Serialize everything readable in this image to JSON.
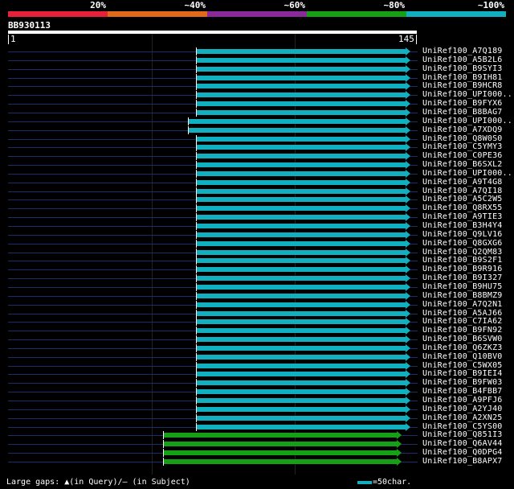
{
  "identity_legend": {
    "labels": [
      "20%",
      "~40%",
      "~60%",
      "~80%",
      "~100%"
    ],
    "colors": [
      "#e8203a",
      "#e06a18",
      "#8a2a9a",
      "#16a016",
      "#10b0c0"
    ]
  },
  "query": {
    "id": "BB930113",
    "start": "1",
    "end": "145",
    "length": 145
  },
  "hits": [
    {
      "label": "UniRef100_A7Q189",
      "q_start": 68,
      "q_end": 144,
      "color": "cyan"
    },
    {
      "label": "UniRef100_A5B2L6",
      "q_start": 68,
      "q_end": 144,
      "color": "cyan"
    },
    {
      "label": "UniRef100_B9SYI3",
      "q_start": 68,
      "q_end": 144,
      "color": "cyan"
    },
    {
      "label": "UniRef100_B9IH81",
      "q_start": 68,
      "q_end": 144,
      "color": "cyan"
    },
    {
      "label": "UniRef100_B9HCR8",
      "q_start": 68,
      "q_end": 144,
      "color": "cyan"
    },
    {
      "label": "UniRef100_UPI000..",
      "q_start": 68,
      "q_end": 144,
      "color": "cyan"
    },
    {
      "label": "UniRef100_B9FYX6",
      "q_start": 68,
      "q_end": 144,
      "color": "cyan"
    },
    {
      "label": "UniRef100_B8BAG7",
      "q_start": 68,
      "q_end": 144,
      "color": "cyan"
    },
    {
      "label": "UniRef100_UPI000..",
      "q_start": 65,
      "q_end": 144,
      "color": "cyan"
    },
    {
      "label": "UniRef100_A7XDQ9",
      "q_start": 65,
      "q_end": 144,
      "color": "cyan"
    },
    {
      "label": "UniRef100_Q8W0S0",
      "q_start": 68,
      "q_end": 144,
      "color": "cyan"
    },
    {
      "label": "UniRef100_C5YMY3",
      "q_start": 68,
      "q_end": 144,
      "color": "cyan"
    },
    {
      "label": "UniRef100_C0PE36",
      "q_start": 68,
      "q_end": 144,
      "color": "cyan"
    },
    {
      "label": "UniRef100_B6SXL2",
      "q_start": 68,
      "q_end": 144,
      "color": "cyan"
    },
    {
      "label": "UniRef100_UPI000..",
      "q_start": 68,
      "q_end": 144,
      "color": "cyan"
    },
    {
      "label": "UniRef100_A9T4G8",
      "q_start": 68,
      "q_end": 144,
      "color": "cyan"
    },
    {
      "label": "UniRef100_A7QI18",
      "q_start": 68,
      "q_end": 144,
      "color": "cyan"
    },
    {
      "label": "UniRef100_A5C2W5",
      "q_start": 68,
      "q_end": 144,
      "color": "cyan"
    },
    {
      "label": "UniRef100_Q8RX55",
      "q_start": 68,
      "q_end": 144,
      "color": "cyan"
    },
    {
      "label": "UniRef100_A9TIE3",
      "q_start": 68,
      "q_end": 144,
      "color": "cyan"
    },
    {
      "label": "UniRef100_B3H4Y4",
      "q_start": 68,
      "q_end": 144,
      "color": "cyan"
    },
    {
      "label": "UniRef100_Q9LV16",
      "q_start": 68,
      "q_end": 144,
      "color": "cyan"
    },
    {
      "label": "UniRef100_Q8GXG6",
      "q_start": 68,
      "q_end": 144,
      "color": "cyan"
    },
    {
      "label": "UniRef100_Q2QM83",
      "q_start": 68,
      "q_end": 144,
      "color": "cyan"
    },
    {
      "label": "UniRef100_B9S2F1",
      "q_start": 68,
      "q_end": 144,
      "color": "cyan"
    },
    {
      "label": "UniRef100_B9R916",
      "q_start": 68,
      "q_end": 144,
      "color": "cyan"
    },
    {
      "label": "UniRef100_B9I327",
      "q_start": 68,
      "q_end": 144,
      "color": "cyan"
    },
    {
      "label": "UniRef100_B9HU75",
      "q_start": 68,
      "q_end": 144,
      "color": "cyan"
    },
    {
      "label": "UniRef100_B8BMZ9",
      "q_start": 68,
      "q_end": 144,
      "color": "cyan"
    },
    {
      "label": "UniRef100_A7Q2N1",
      "q_start": 68,
      "q_end": 144,
      "color": "cyan"
    },
    {
      "label": "UniRef100_A5AJ66",
      "q_start": 68,
      "q_end": 144,
      "color": "cyan"
    },
    {
      "label": "UniRef100_C7IA62",
      "q_start": 68,
      "q_end": 144,
      "color": "cyan"
    },
    {
      "label": "UniRef100_B9FN92",
      "q_start": 68,
      "q_end": 144,
      "color": "cyan"
    },
    {
      "label": "UniRef100_B6SVW0",
      "q_start": 68,
      "q_end": 144,
      "color": "cyan"
    },
    {
      "label": "UniRef100_Q6ZKZ3",
      "q_start": 68,
      "q_end": 144,
      "color": "cyan"
    },
    {
      "label": "UniRef100_Q10BV0",
      "q_start": 68,
      "q_end": 144,
      "color": "cyan"
    },
    {
      "label": "UniRef100_C5WX05",
      "q_start": 68,
      "q_end": 144,
      "color": "cyan"
    },
    {
      "label": "UniRef100_B9IEI4",
      "q_start": 68,
      "q_end": 144,
      "color": "cyan"
    },
    {
      "label": "UniRef100_B9FW03",
      "q_start": 68,
      "q_end": 144,
      "color": "cyan"
    },
    {
      "label": "UniRef100_B4FBB7",
      "q_start": 68,
      "q_end": 144,
      "color": "cyan"
    },
    {
      "label": "UniRef100_A9PFJ6",
      "q_start": 68,
      "q_end": 144,
      "color": "cyan"
    },
    {
      "label": "UniRef100_A2YJ40",
      "q_start": 68,
      "q_end": 144,
      "color": "cyan"
    },
    {
      "label": "UniRef100_A2XN25",
      "q_start": 68,
      "q_end": 144,
      "color": "cyan"
    },
    {
      "label": "UniRef100_C5YS00",
      "q_start": 68,
      "q_end": 144,
      "color": "cyan"
    },
    {
      "label": "UniRef100_Q851I3",
      "q_start": 56,
      "q_end": 141,
      "color": "green"
    },
    {
      "label": "UniRef100_Q6AV44",
      "q_start": 56,
      "q_end": 141,
      "color": "green"
    },
    {
      "label": "UniRef100_Q0DPG4",
      "q_start": 56,
      "q_end": 141,
      "color": "green"
    },
    {
      "label": "UniRef100_B8APX7",
      "q_start": 56,
      "q_end": 141,
      "color": "green"
    }
  ],
  "hit_colors": {
    "cyan": "#10b0c0",
    "green": "#16a016"
  },
  "footer": {
    "gaps_text": "Large gaps: ▲(in Query)/– (in Subject)",
    "scale_text": "=50char."
  }
}
